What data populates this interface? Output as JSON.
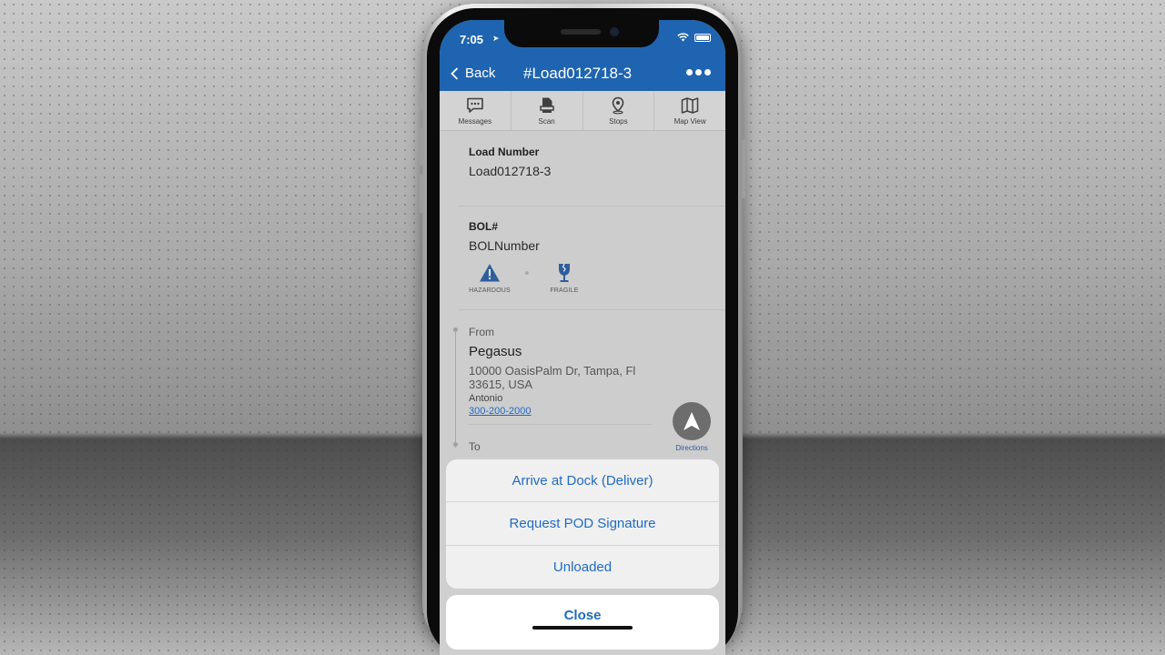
{
  "status": {
    "time": "7:05"
  },
  "nav": {
    "back_label": "Back",
    "title": "#Load012718-3"
  },
  "toolbar": [
    {
      "label": "Messages",
      "icon": "messages-icon"
    },
    {
      "label": "Scan",
      "icon": "scan-icon"
    },
    {
      "label": "Stops",
      "icon": "stops-icon"
    },
    {
      "label": "Map View",
      "icon": "map-view-icon"
    }
  ],
  "load": {
    "label": "Load Number",
    "value": "Load012718-3"
  },
  "bol": {
    "label": "BOL#",
    "value": "BOLNumber"
  },
  "attributes": [
    {
      "label": "HAZARDOUS",
      "icon": "hazard-warning-icon"
    },
    {
      "label": "FRAGILE",
      "icon": "fragile-glass-icon"
    }
  ],
  "from": {
    "label": "From",
    "name": "Pegasus",
    "address": "10000 OasisPalm Dr, Tampa, Fl 33615, USA",
    "contact": "Antonio",
    "phone": "300-200-2000"
  },
  "to": {
    "label": "To"
  },
  "directions": {
    "label": "Directions"
  },
  "action_sheet": {
    "items": [
      "Arrive at Dock (Deliver)",
      "Request POD Signature",
      "Unloaded"
    ],
    "close_label": "Close"
  },
  "colors": {
    "nav_blue": "#1f64b0",
    "link_blue": "#1f6bc4",
    "screen_dimmed": "#cdcdcd"
  }
}
